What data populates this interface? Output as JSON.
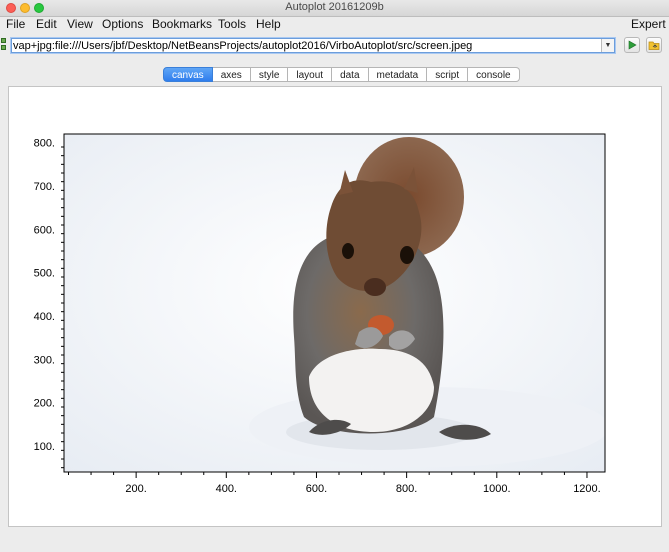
{
  "window": {
    "title": "Autoplot 20161209b"
  },
  "menubar": {
    "items": [
      "File",
      "Edit",
      "View",
      "Options",
      "Bookmarks",
      "Tools",
      "Help"
    ],
    "right": "Expert"
  },
  "data_source": {
    "url": "vap+jpg:file:///Users/jbf/Desktop/NetBeansProjects/autoplot2016/VirboAutoplot/src/screen.jpeg"
  },
  "tabs": [
    {
      "label": "canvas",
      "active": true
    },
    {
      "label": "axes"
    },
    {
      "label": "style"
    },
    {
      "label": "layout"
    },
    {
      "label": "data"
    },
    {
      "label": "metadata"
    },
    {
      "label": "script"
    },
    {
      "label": "console"
    }
  ],
  "plot": {
    "image": {
      "subject": "squirrel-in-snow-photo"
    },
    "x_axis": {
      "range": [
        40,
        1240
      ],
      "major_ticks": [
        200,
        400,
        600,
        800,
        1000,
        1200
      ],
      "labels": [
        "200.",
        "400.",
        "600.",
        "800.",
        "1000.",
        "1200."
      ]
    },
    "y_axis": {
      "range": [
        40,
        820
      ],
      "major_ticks": [
        100,
        200,
        300,
        400,
        500,
        600,
        700,
        800
      ],
      "labels": [
        "100.",
        "200.",
        "300.",
        "400.",
        "500.",
        "600.",
        "700.",
        "800."
      ]
    }
  }
}
